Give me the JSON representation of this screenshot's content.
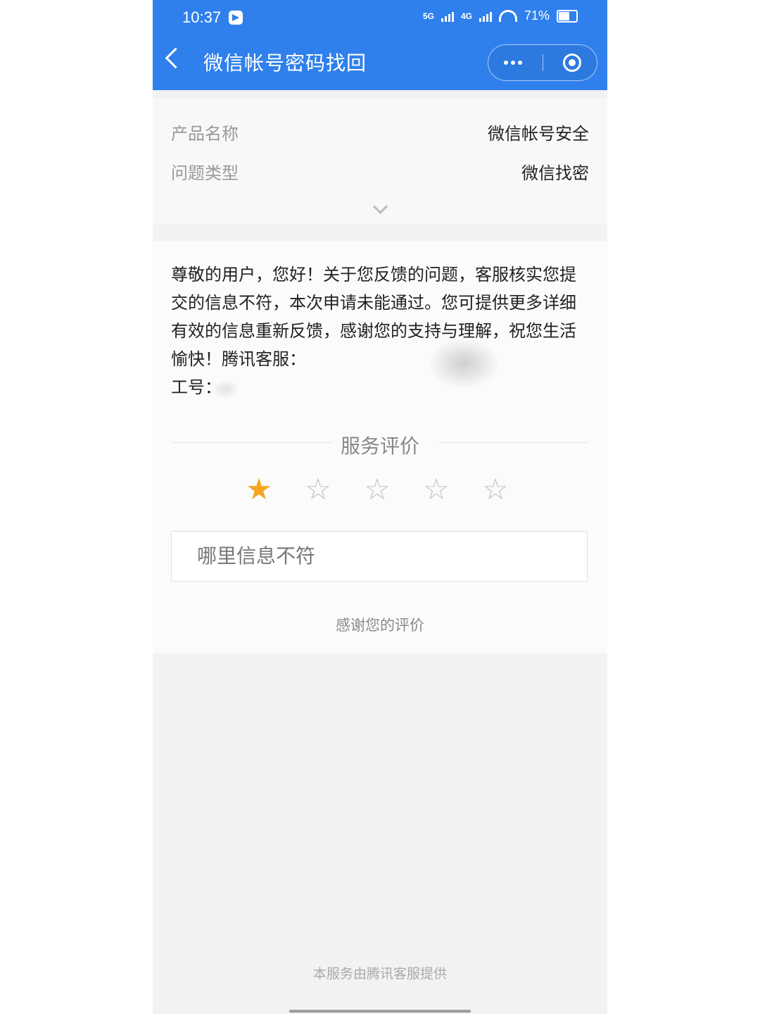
{
  "status": {
    "time": "10:37",
    "net1": "5G",
    "net2": "4G",
    "battery": "71%"
  },
  "nav": {
    "title": "微信帐号密码找回"
  },
  "info": [
    {
      "label": "产品名称",
      "value": "微信帐号安全"
    },
    {
      "label": "问题类型",
      "value": "微信找密"
    }
  ],
  "message": "尊敬的用户，您好！关于您反馈的问题，客服核实您提交的信息不符，本次申请未能通过。您可提供更多详细有效的信息重新反馈，感谢您的支持与理解，祝您生活愉快！腾讯客服：\n工号：",
  "rating": {
    "title": "服务评价",
    "stars": 1,
    "max": 5
  },
  "feedback_placeholder": "哪里信息不符",
  "thanks_text": "感谢您的评价",
  "footer": "本服务由腾讯客服提供",
  "colors": {
    "nav": "#2f80ed",
    "star_active": "#f5a623"
  }
}
